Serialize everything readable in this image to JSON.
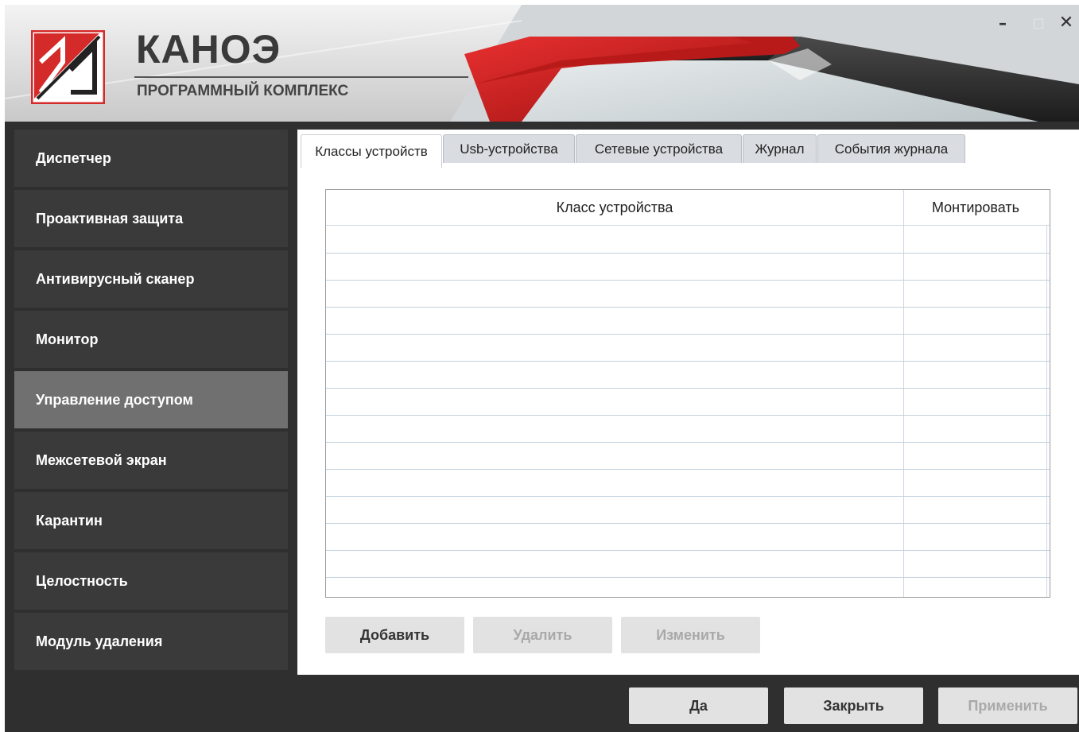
{
  "brand": {
    "title": "КАНОЭ",
    "subtitle": "ПРОГРАММНЫЙ КОМПЛЕКС"
  },
  "window_controls": {
    "minimize": "–",
    "maximize": "□",
    "close": "✕"
  },
  "sidebar": {
    "items": [
      {
        "label": "Диспетчер",
        "active": false
      },
      {
        "label": "Проактивная защита",
        "active": false
      },
      {
        "label": "Антивирусный сканер",
        "active": false
      },
      {
        "label": "Монитор",
        "active": false
      },
      {
        "label": "Управление доступом",
        "active": true
      },
      {
        "label": "Межсетевой экран",
        "active": false
      },
      {
        "label": "Карантин",
        "active": false
      },
      {
        "label": "Целостность",
        "active": false
      },
      {
        "label": "Модуль удаления",
        "active": false
      }
    ]
  },
  "tabs": [
    {
      "label": "Классы устройств",
      "active": true
    },
    {
      "label": "Usb-устройства",
      "active": false
    },
    {
      "label": "Сетевые устройства",
      "active": false
    },
    {
      "label": "Журнал",
      "active": false
    },
    {
      "label": "События журнала",
      "active": false
    }
  ],
  "table": {
    "columns": [
      "Класс устройства",
      "Монтировать"
    ],
    "rows": []
  },
  "actions": {
    "add": "Добавить",
    "delete": "Удалить",
    "edit": "Изменить"
  },
  "footer": {
    "yes": "Да",
    "close": "Закрыть",
    "apply": "Применить"
  },
  "colors": {
    "accent_red": "#d42a2a",
    "sidebar_bg": "#3a3a3a",
    "sidebar_active": "#707070",
    "window_bg": "#2f2f2f"
  }
}
